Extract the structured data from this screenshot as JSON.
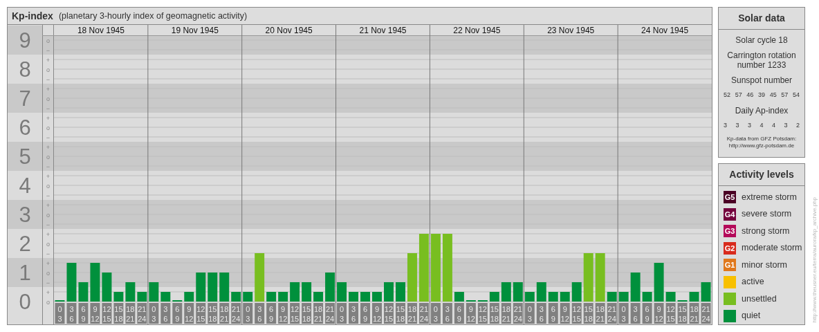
{
  "title": "Kp-index",
  "subtitle": "(planetary 3-hourly index of geomagnetic activity)",
  "minor_ticks": [
    "o",
    "−",
    "+",
    "o",
    "−",
    "+",
    "o",
    "−",
    "+",
    "o",
    "−",
    "+",
    "o",
    "−",
    "+",
    "o",
    "−",
    "+",
    "o",
    "−",
    "+",
    "o",
    "−",
    "+",
    "o",
    "−",
    "+",
    "o"
  ],
  "days": [
    {
      "date": "18 Nov 1945",
      "slots": [
        {
          "from": "0",
          "to": "3"
        },
        {
          "from": "3",
          "to": "6"
        },
        {
          "from": "6",
          "to": "9"
        },
        {
          "from": "9",
          "to": "12"
        },
        {
          "from": "12",
          "to": "15"
        },
        {
          "from": "15",
          "to": "18"
        },
        {
          "from": "18",
          "to": "21"
        },
        {
          "from": "21",
          "to": "24"
        }
      ]
    },
    {
      "date": "19 Nov 1945",
      "slots": [
        {
          "from": "0",
          "to": "3"
        },
        {
          "from": "3",
          "to": "6"
        },
        {
          "from": "6",
          "to": "9"
        },
        {
          "from": "9",
          "to": "12"
        },
        {
          "from": "12",
          "to": "15"
        },
        {
          "from": "15",
          "to": "18"
        },
        {
          "from": "18",
          "to": "21"
        },
        {
          "from": "21",
          "to": "24"
        }
      ]
    },
    {
      "date": "20 Nov 1945",
      "slots": [
        {
          "from": "0",
          "to": "3"
        },
        {
          "from": "3",
          "to": "6"
        },
        {
          "from": "6",
          "to": "9"
        },
        {
          "from": "9",
          "to": "12"
        },
        {
          "from": "12",
          "to": "15"
        },
        {
          "from": "15",
          "to": "18"
        },
        {
          "from": "18",
          "to": "21"
        },
        {
          "from": "21",
          "to": "24"
        }
      ]
    },
    {
      "date": "21 Nov 1945",
      "slots": [
        {
          "from": "0",
          "to": "3"
        },
        {
          "from": "3",
          "to": "6"
        },
        {
          "from": "6",
          "to": "9"
        },
        {
          "from": "9",
          "to": "12"
        },
        {
          "from": "12",
          "to": "15"
        },
        {
          "from": "15",
          "to": "18"
        },
        {
          "from": "18",
          "to": "21"
        },
        {
          "from": "21",
          "to": "24"
        }
      ]
    },
    {
      "date": "22 Nov 1945",
      "slots": [
        {
          "from": "0",
          "to": "3"
        },
        {
          "from": "3",
          "to": "6"
        },
        {
          "from": "6",
          "to": "9"
        },
        {
          "from": "9",
          "to": "12"
        },
        {
          "from": "12",
          "to": "15"
        },
        {
          "from": "15",
          "to": "18"
        },
        {
          "from": "18",
          "to": "21"
        },
        {
          "from": "21",
          "to": "24"
        }
      ]
    },
    {
      "date": "23 Nov 1945",
      "slots": [
        {
          "from": "0",
          "to": "3"
        },
        {
          "from": "3",
          "to": "6"
        },
        {
          "from": "6",
          "to": "9"
        },
        {
          "from": "9",
          "to": "12"
        },
        {
          "from": "12",
          "to": "15"
        },
        {
          "from": "15",
          "to": "18"
        },
        {
          "from": "18",
          "to": "21"
        },
        {
          "from": "21",
          "to": "24"
        }
      ]
    },
    {
      "date": "24 Nov 1945",
      "slots": [
        {
          "from": "0",
          "to": "3"
        },
        {
          "from": "3",
          "to": "6"
        },
        {
          "from": "6",
          "to": "9"
        },
        {
          "from": "9",
          "to": "12"
        },
        {
          "from": "12",
          "to": "15"
        },
        {
          "from": "15",
          "to": "18"
        },
        {
          "from": "18",
          "to": "21"
        },
        {
          "from": "21",
          "to": "24"
        }
      ]
    }
  ],
  "chart_data": {
    "type": "bar",
    "ylim": [
      0,
      9
    ],
    "grid": true,
    "yticks": [
      {
        "value": 9,
        "label": "9"
      },
      {
        "value": 8,
        "label": "8"
      },
      {
        "value": 7,
        "label": "7"
      },
      {
        "value": 6,
        "label": "6"
      },
      {
        "value": 5,
        "label": "5"
      },
      {
        "value": 4,
        "label": "4"
      },
      {
        "value": 3,
        "label": "3"
      },
      {
        "value": 2,
        "label": "2"
      },
      {
        "value": 1,
        "label": "1"
      },
      {
        "value": 0,
        "label": "0"
      }
    ],
    "series": [
      {
        "color": "#00903c",
        "values": [
          0,
          1.33,
          0.67,
          1.33,
          1,
          0.33,
          0.67,
          0.33,
          0.67,
          0.33,
          0,
          0.33,
          1,
          1,
          1,
          0.33,
          0.33,
          null,
          0.33,
          0.33,
          0.67,
          0.67,
          0.33,
          1,
          0.67,
          0.33,
          0.33,
          0.33,
          0.67,
          0.67,
          null,
          null,
          null,
          null,
          0.33,
          0,
          0,
          0.33,
          0.67,
          0.67,
          0.33,
          0.67,
          0.33,
          0.33,
          0.67,
          null,
          null,
          0.33,
          0.33,
          1,
          0.33,
          1.33,
          0.33,
          0,
          0.33,
          0.67
        ]
      },
      {
        "color": "#78be20",
        "values": [
          null,
          null,
          null,
          null,
          null,
          null,
          null,
          null,
          null,
          null,
          null,
          null,
          null,
          null,
          null,
          null,
          null,
          1.67,
          null,
          null,
          null,
          null,
          null,
          null,
          null,
          null,
          null,
          null,
          null,
          null,
          1.67,
          2.33,
          2.33,
          2.33,
          null,
          null,
          null,
          null,
          null,
          null,
          null,
          null,
          null,
          null,
          null,
          1.67,
          1.67,
          null,
          null,
          null,
          null,
          null,
          null,
          null,
          null,
          null
        ]
      }
    ]
  },
  "solar": {
    "title": "Solar data",
    "cycle": "Solar cycle 18",
    "rotation": "Carrington rotation number 1233",
    "sunspot_title": "Sunspot number",
    "sunspots": [
      "52",
      "57",
      "46",
      "39",
      "45",
      "57",
      "54"
    ],
    "ap_title": "Daily Ap-index",
    "ap": [
      "3",
      "3",
      "3",
      "4",
      "4",
      "3",
      "2"
    ],
    "source": "Kp-data from GFZ Potsdam:",
    "source_url": "http://www.gfz-potsdam.de"
  },
  "legend": {
    "title": "Activity levels",
    "items": [
      {
        "badge": "G5",
        "label": "extreme storm",
        "color": "#4a0024"
      },
      {
        "badge": "G4",
        "label": "severe storm",
        "color": "#74003c"
      },
      {
        "badge": "G3",
        "label": "strong storm",
        "color": "#b40a5a"
      },
      {
        "badge": "G2",
        "label": "moderate storm",
        "color": "#d82a1c"
      },
      {
        "badge": "G1",
        "label": "minor storm",
        "color": "#e0781c"
      },
      {
        "label": "active",
        "color": "#f8c000"
      },
      {
        "label": "unsettled",
        "color": "#78be20"
      },
      {
        "label": "quiet",
        "color": "#00903c"
      }
    ]
  },
  "credit": "http://www.theusner.eu/terra/aurora/kp_archive.php"
}
